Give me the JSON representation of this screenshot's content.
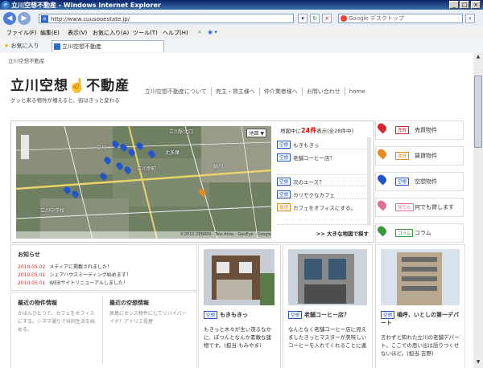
{
  "window": {
    "title": "立川空想不動産 - Windows Internet Explorer"
  },
  "address": {
    "url": "http://www.cuusooestate.jp/",
    "search_placeholder": "Google デスクトップ"
  },
  "menu": [
    "ファイル(F)",
    "編集(E)",
    "表示(V)",
    "お気に入り(A)",
    "ツール(T)",
    "ヘルプ(H)"
  ],
  "favorites": {
    "label": "お気に入り",
    "tab_title": "立川空想不動産"
  },
  "page": {
    "breadcrumb": "立川空想不動産",
    "logo": "立川空想",
    "logo2": "不動産",
    "tagline": "グッと来る物件が増えると、街はきっと変わる",
    "nav": [
      "立川空想不動産について",
      "売主・貸主様へ",
      "仲介業者様へ",
      "お問い合わせ",
      "home"
    ]
  },
  "map": {
    "type_selector": "地図 ▼",
    "footer": "©2010 ZENRIN · Tele Atlas · GeoEye · Google",
    "labels": [
      "立川駅北口",
      "北多摩",
      "立川",
      "立川幸町",
      "砂川",
      "立川中学校"
    ]
  },
  "listing": {
    "header_prefix": "地図中に",
    "count": "24件",
    "header_suffix": "表示(全28件中)",
    "items": [
      {
        "badge": "空想",
        "text": "もきもきっ"
      },
      {
        "badge": "空想",
        "text": "老舗コーヒー店？"
      },
      {
        "badge": "空想",
        "text": "次のエース？"
      },
      {
        "badge": "空想",
        "text": "カリモクなカフェ"
      },
      {
        "badge": "賃貸",
        "text": "カフェをオフィスにする。"
      }
    ],
    "bigmap": ">> 大きな地図で探す"
  },
  "categories": [
    {
      "badge": "売買",
      "label": "売買物件",
      "color": "#d9262c"
    },
    {
      "badge": "賃貸",
      "label": "賃貸物件",
      "color": "#e98b1c"
    },
    {
      "badge": "空想",
      "label": "空想物件",
      "color": "#2255cc"
    },
    {
      "badge": "何でも",
      "label": "何でも貸します",
      "color": "#e0709a"
    },
    {
      "badge": "コラム",
      "label": "コラム",
      "color": "#3a9a3a"
    }
  ],
  "news": {
    "title": "お知らせ",
    "items": [
      {
        "date": "2010.05.02",
        "text": "メディアに掲載されました！"
      },
      {
        "date": "2010.05.01",
        "text": "シェアハウスミーティング始めます！"
      },
      {
        "date": "2010.05.01",
        "text": "WEBサイトリニューアルしました！"
      }
    ]
  },
  "latest": {
    "left_title": "最近の物件情報",
    "left_text": "かぼんひとつで、カフェをオフィスにする。シネマ通りで共同生活を始める。",
    "right_title": "最近の空想情報",
    "right_text": "高島にセンス物件にしてリバイバーイチ！アトリエ長屋"
  },
  "cards": [
    {
      "badge": "空想",
      "title": "もきもきっ",
      "text": "もきっと木々が生い茂るなかに、ぽつんとなんか素敵な建物です。(担当:もみやま)"
    },
    {
      "badge": "空想",
      "title": "老舗コーヒー店？",
      "text": "なんとなく老舗コーヒー店に見えましたきっとマスターが美味しいコーヒーを入れてくれることに違"
    },
    {
      "badge": "空想",
      "title": "鳴呼、いとしの第一デパート",
      "text": "言わずと知れた立川の老舗デパート。ここでの思い出は語りつくせないほど。(担当:吉野)"
    }
  ]
}
